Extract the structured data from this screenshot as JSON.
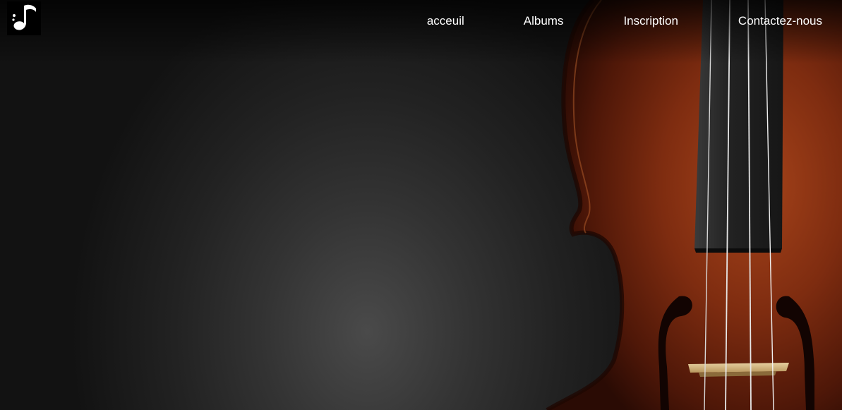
{
  "logo": {
    "icon": "music-note-icon",
    "background": "#000000",
    "color": "#ffffff"
  },
  "nav": {
    "items": [
      {
        "label": "acceuil"
      },
      {
        "label": "Albums"
      },
      {
        "label": "Inscription"
      },
      {
        "label": "Contactez-nous"
      }
    ]
  },
  "hero": {
    "image": "violin-image",
    "colors": {
      "background": "#2a2a2a",
      "wood": "#7a2a10",
      "fingerboard": "#2b2b2b",
      "strings": "#e8e8e8"
    }
  }
}
